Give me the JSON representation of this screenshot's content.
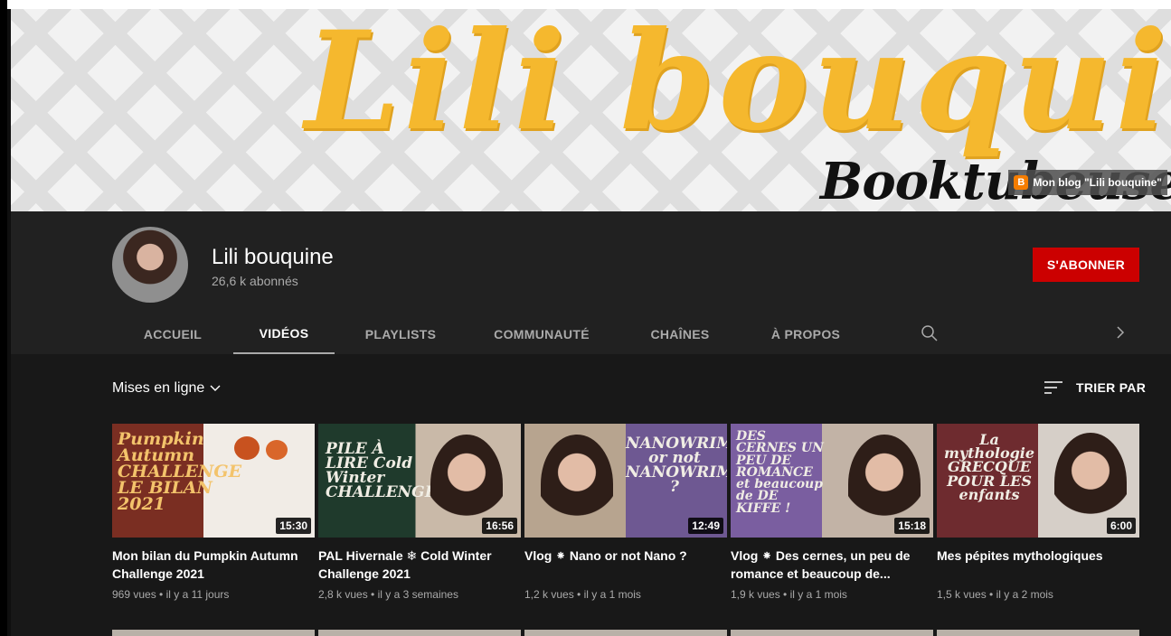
{
  "banner": {
    "title": "Lili bouquine",
    "subtitle": "Booktubeuse",
    "link_label": "Mon blog \"Lili bouquine\""
  },
  "channel": {
    "name": "Lili bouquine",
    "subscribers": "26,6 k abonnés",
    "subscribe_label": "S'ABONNER"
  },
  "tabs": [
    {
      "label": "ACCUEIL",
      "active": false
    },
    {
      "label": "VIDÉOS",
      "active": true
    },
    {
      "label": "PLAYLISTS",
      "active": false
    },
    {
      "label": "COMMUNAUTÉ",
      "active": false
    },
    {
      "label": "CHAÎNES",
      "active": false
    },
    {
      "label": "À PROPOS",
      "active": false
    }
  ],
  "filter": {
    "label": "Mises en ligne"
  },
  "sort": {
    "label": "TRIER PAR"
  },
  "videos": [
    {
      "title": "Mon bilan du Pumpkin Autumn Challenge 2021",
      "views": "969 vues",
      "age": "il y a 11 jours",
      "duration": "15:30",
      "thumb_text": "Pumpkin Autumn CHALLENGE LE BILAN 2021"
    },
    {
      "title": "PAL Hivernale ❄ Cold Winter Challenge 2021",
      "views": "2,8 k vues",
      "age": "il y a 3 semaines",
      "duration": "16:56",
      "thumb_text": "PILE À LIRE Cold Winter CHALLENGE"
    },
    {
      "title": "Vlog ⁕ Nano or not Nano ?",
      "views": "1,2 k vues",
      "age": "il y a 1 mois",
      "duration": "12:49",
      "thumb_text": "NANOWRIMO or not NANOWRIMO ?"
    },
    {
      "title": "Vlog ⁕ Des cernes, un peu de romance et beaucoup de...",
      "views": "1,9 k vues",
      "age": "il y a 1 mois",
      "duration": "15:18",
      "thumb_text": "DES CERNES UN PEU DE ROMANCE et beaucoup de DE KIFFE !"
    },
    {
      "title": "Mes pépites mythologiques",
      "views": "1,5 k vues",
      "age": "il y a 2 mois",
      "duration": "6:00",
      "thumb_text": "La mythologie GRECQUE POUR LES enfants"
    }
  ],
  "colors": {
    "subscribe": "#cc0000",
    "banner_yellow": "#f5b82e",
    "header_bg": "#212121",
    "content_bg": "#181818"
  },
  "icons": [
    "search-icon",
    "chevron-right-icon",
    "chevron-down-icon",
    "sort-icon",
    "blogger-icon"
  ]
}
